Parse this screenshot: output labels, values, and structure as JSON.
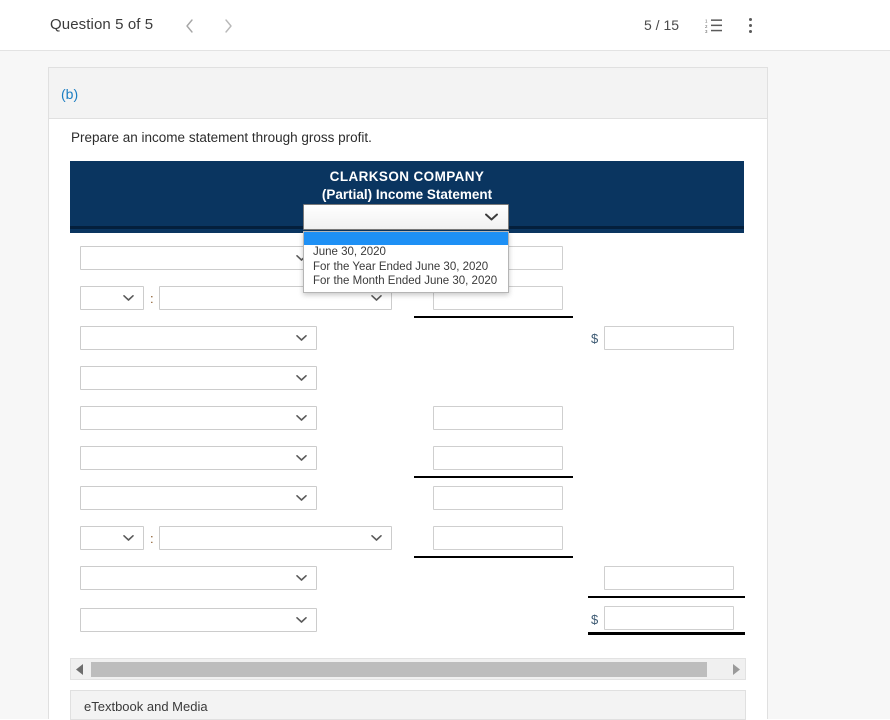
{
  "topbar": {
    "question_label": "Question 5 of 5",
    "prev_icon": "chevron-left-icon",
    "next_icon": "chevron-right-icon",
    "page_count": "5 / 15",
    "list_icon": "ordered-list-icon",
    "menu_icon": "kebab-menu-icon"
  },
  "card": {
    "part_label": "(b)",
    "prompt": "Prepare an income statement through gross profit."
  },
  "statement": {
    "company": "CLARKSON COMPANY",
    "title": "(Partial) Income Statement",
    "period_select": {
      "value": "",
      "expanded": true,
      "options": [
        "",
        "June 30, 2020",
        "For the Year Ended June 30, 2020",
        "For the Month Ended June 30, 2020"
      ],
      "highlighted_index": 0
    }
  },
  "rows": [
    {
      "name": "row-1",
      "label_select": "",
      "amount_mid": "",
      "amount_right": null
    },
    {
      "name": "row-2",
      "label_small_select": "",
      "separator": ":",
      "label_select": "",
      "amount_mid": "",
      "amount_right": null
    },
    {
      "name": "row-3",
      "label_select": "",
      "amount_mid": null,
      "amount_right": "",
      "currency": "$"
    },
    {
      "name": "row-4",
      "label_select": "",
      "amount_mid": null,
      "amount_right": null
    },
    {
      "name": "row-5",
      "label_select": "",
      "amount_mid": "",
      "amount_right": null
    },
    {
      "name": "row-6",
      "label_select": "",
      "amount_mid": "",
      "amount_right": null
    },
    {
      "name": "row-7",
      "label_select": "",
      "amount_mid": "",
      "amount_right": null
    },
    {
      "name": "row-8",
      "label_small_select": "",
      "separator": ":",
      "label_select": "",
      "amount_mid": "",
      "amount_right": null
    },
    {
      "name": "row-9",
      "label_select": "",
      "amount_mid": null,
      "amount_right": ""
    },
    {
      "name": "row-10",
      "label_select": "",
      "amount_mid": null,
      "amount_right": "",
      "currency": "$"
    }
  ],
  "scrollbar": {
    "left_arrow_icon": "triangle-left-icon",
    "right_arrow_icon": "triangle-right-icon",
    "orientation": "horizontal"
  },
  "etextbook": {
    "label": "eTextbook and Media"
  },
  "colors": {
    "statement_band": "#0a3560",
    "statement_rule": "#041f3c",
    "accent_link": "#1b7ec2",
    "dropdown_highlight": "#1e90f5",
    "page_background": "#f7f7f7",
    "scrollbar_thumb": "#bdbdbd"
  }
}
